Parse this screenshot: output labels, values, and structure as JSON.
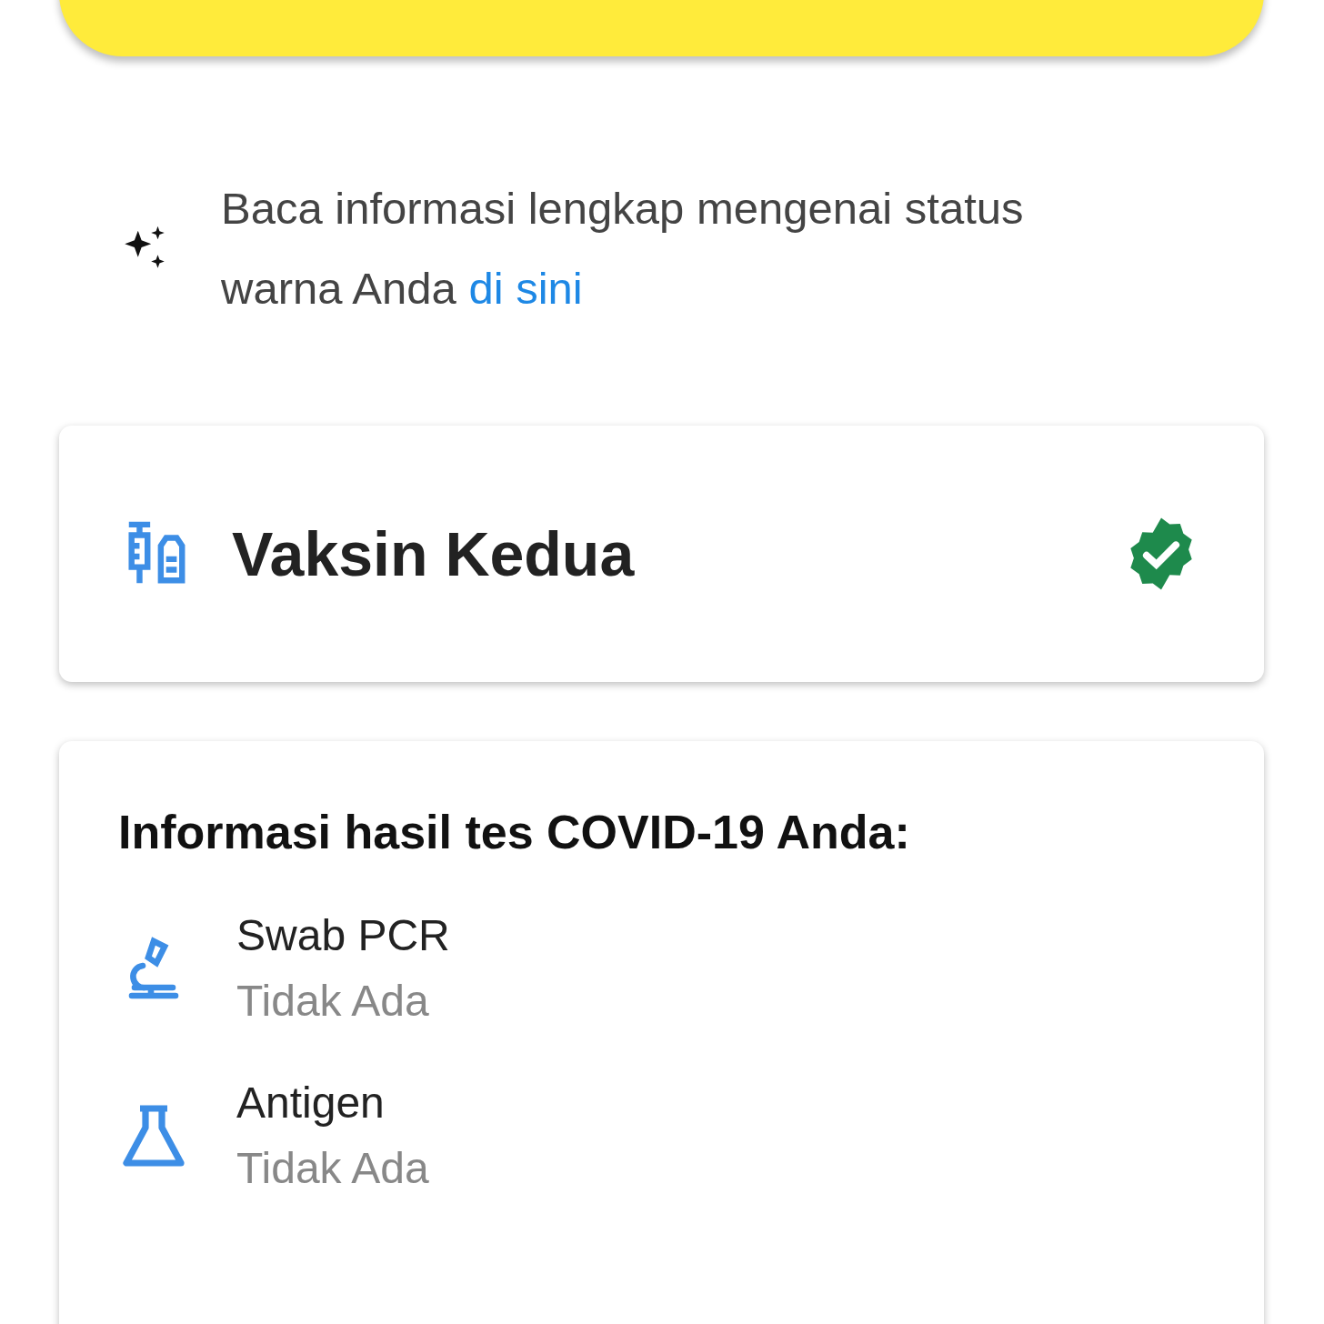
{
  "info": {
    "text": "Baca informasi lengkap mengenai status warna Anda",
    "link": "di sini"
  },
  "vaccine": {
    "title": "Vaksin Kedua",
    "verified": true
  },
  "tests": {
    "heading": "Informasi hasil tes COVID-19 Anda:",
    "items": [
      {
        "kind": "pcr",
        "name": "Swab PCR",
        "result": "Tidak Ada"
      },
      {
        "kind": "antigen",
        "name": "Antigen",
        "result": "Tidak Ada"
      }
    ]
  }
}
